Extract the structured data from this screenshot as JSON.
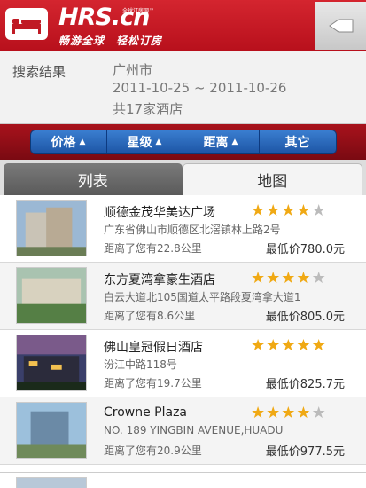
{
  "header": {
    "logo_text": "HRS.cn",
    "logo_sub": "全球订房网™",
    "slogan": "畅游全球　轻松订房"
  },
  "summary": {
    "label": "搜索结果",
    "city": "广州市",
    "dates": "2011-10-25 ~ 2011-10-26",
    "count": "共17家酒店"
  },
  "sort": {
    "items": [
      {
        "label": "价格",
        "has_arrow": true
      },
      {
        "label": "星级",
        "has_arrow": true
      },
      {
        "label": "距离",
        "has_arrow": true
      },
      {
        "label": "其它",
        "has_arrow": false
      }
    ]
  },
  "tabs": {
    "list": "列表",
    "map": "地图"
  },
  "hotels": [
    {
      "name": "顺德金茂华美达广场",
      "address": "广东省佛山市顺德区北滘镇林上路2号",
      "distance": "距离了您有22.8公里",
      "price": "最低价780.0元",
      "stars": 4
    },
    {
      "name": "东方夏湾拿豪生酒店",
      "address": "白云大道北105国道太平路段夏湾拿大道1",
      "distance": "距离了您有8.6公里",
      "price": "最低价805.0元",
      "stars": 4
    },
    {
      "name": "佛山皇冠假日酒店",
      "address": "汾江中路118号",
      "distance": "距离了您有19.7公里",
      "price": "最低价825.7元",
      "stars": 5
    },
    {
      "name": "Crowne Plaza",
      "address": "NO. 189 YINGBIN AVENUE,HUADU",
      "distance": "距离了您有20.9公里",
      "price": "最低价977.5元",
      "stars": 4
    }
  ],
  "colors": {
    "header_red": "#c01a24",
    "sort_blue": "#2a66b8",
    "star_gold": "#f0a914"
  }
}
